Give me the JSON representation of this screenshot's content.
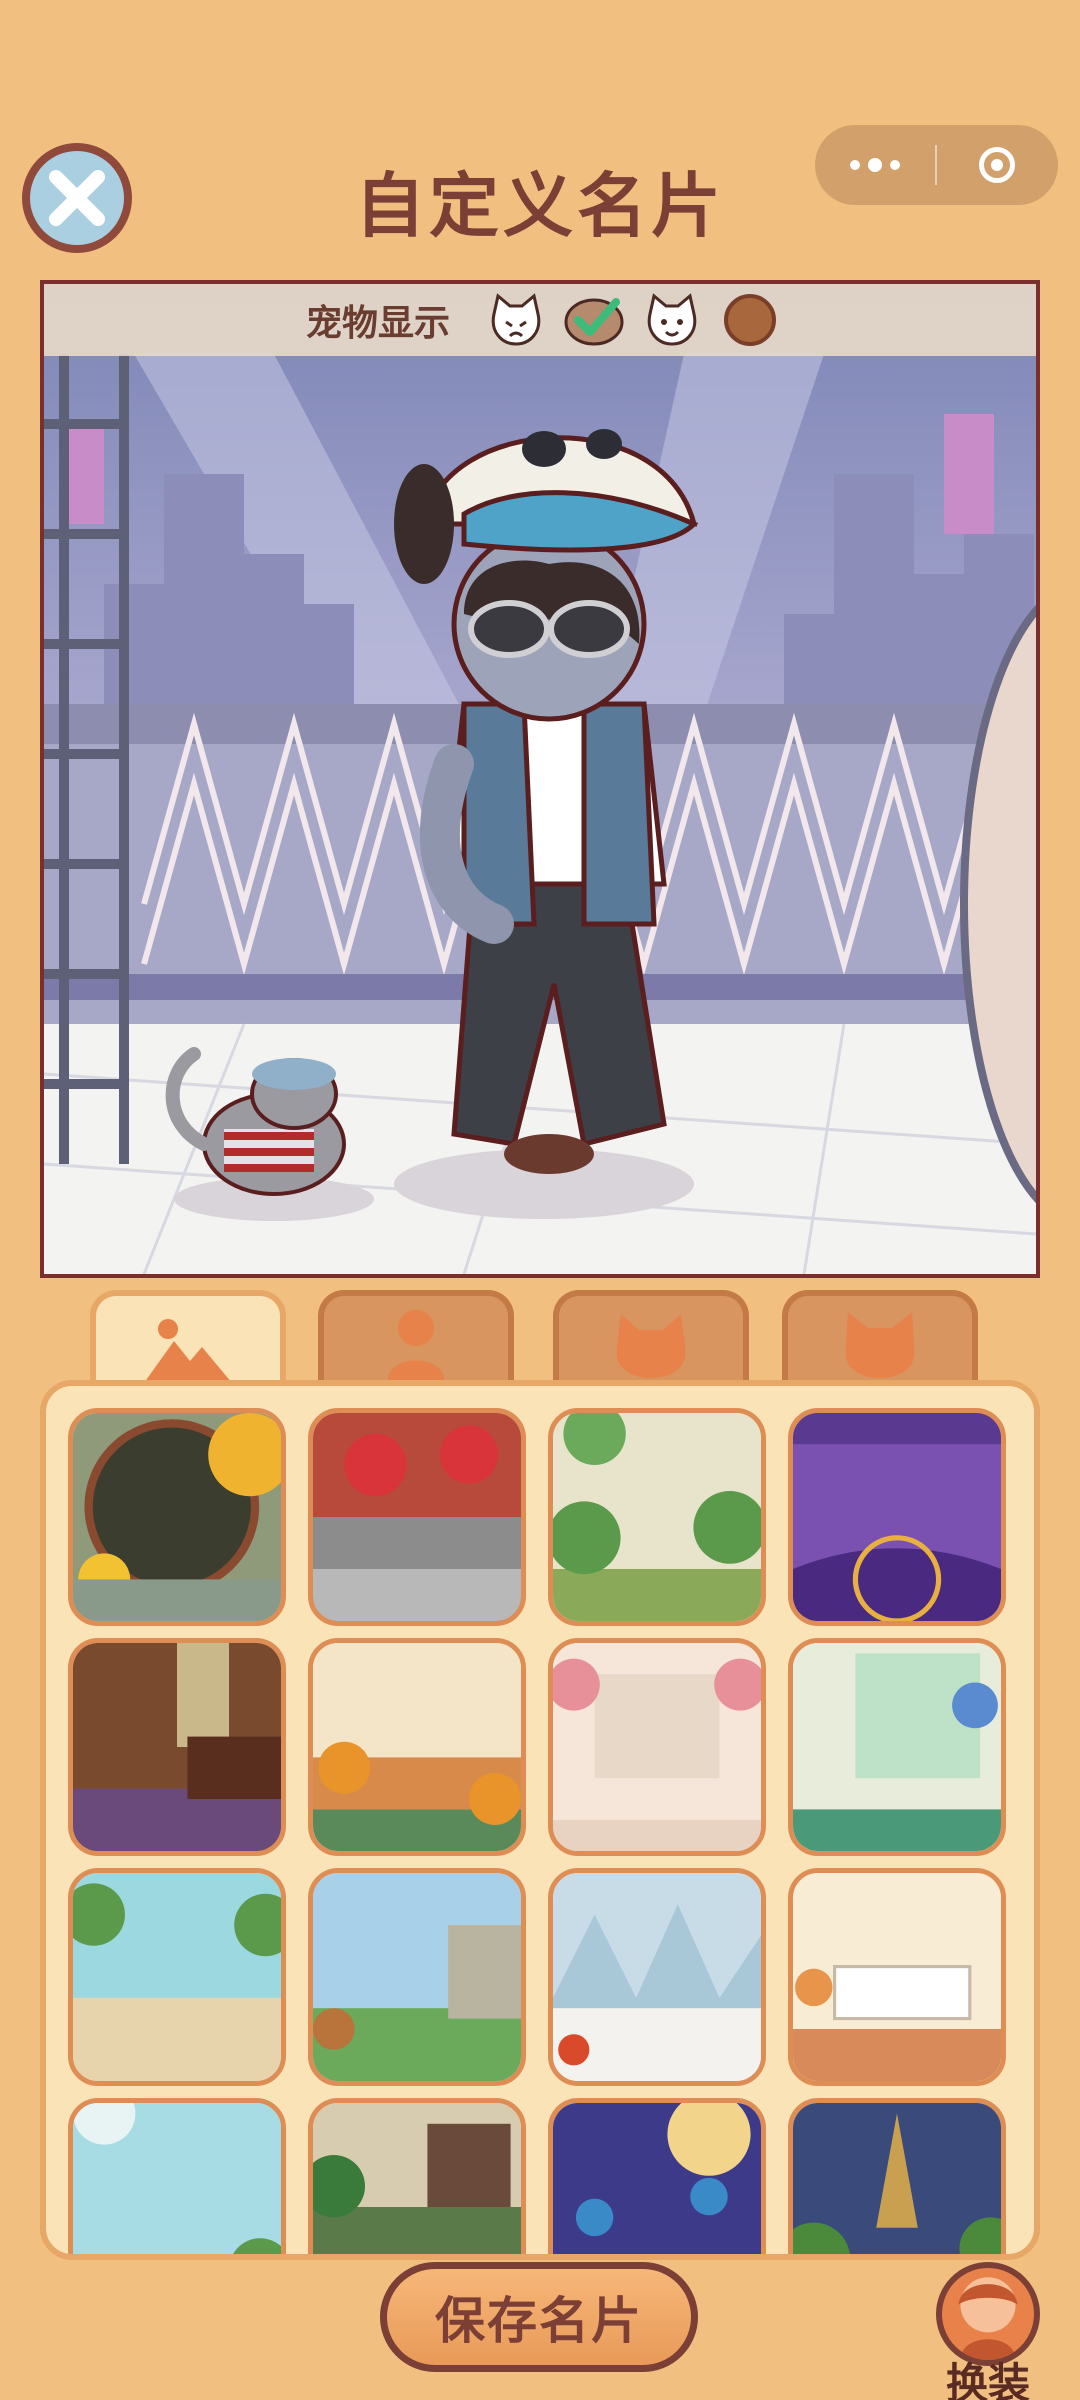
{
  "header": {
    "title": "自定义名片",
    "close_icon": "close-icon",
    "more_icon": "more-dots-icon",
    "target_icon": "target-icon"
  },
  "scene": {
    "pet_bar": {
      "label": "宠物显示",
      "options": [
        {
          "name": "cat-sad-icon",
          "selected": false
        },
        {
          "name": "check-icon",
          "selected": true
        },
        {
          "name": "cat-happy-icon",
          "selected": false
        },
        {
          "name": "color-dot-brown",
          "selected": false
        }
      ]
    }
  },
  "tabs": [
    {
      "name": "tab-background",
      "icon": "mountain-icon",
      "active": true
    },
    {
      "name": "tab-character",
      "icon": "person-icon",
      "active": false
    },
    {
      "name": "tab-pet",
      "icon": "cat-face-icon",
      "active": false
    },
    {
      "name": "tab-pet-2",
      "icon": "cat-head-icon",
      "active": false
    }
  ],
  "backgrounds": [
    "autumn-moon-window",
    "red-plum-courtyard",
    "garden-brick-wall",
    "purple-stage",
    "wooden-study",
    "pumpkin-room",
    "floral-bedroom",
    "greenhouse-window",
    "tropical-beach",
    "rustic-farm",
    "snowy-forest",
    "cozy-bedroom",
    "sky-meadow",
    "jungle-window",
    "night-lantern",
    "golden-tower"
  ],
  "colors": {
    "page_bg": "#F1C080",
    "panel_bg": "#FBE3B8",
    "accent_brown": "#7C3F36",
    "tab_inactive": "#D99560"
  },
  "bottom": {
    "save_label": "保存名片",
    "dress_label": "换装"
  }
}
